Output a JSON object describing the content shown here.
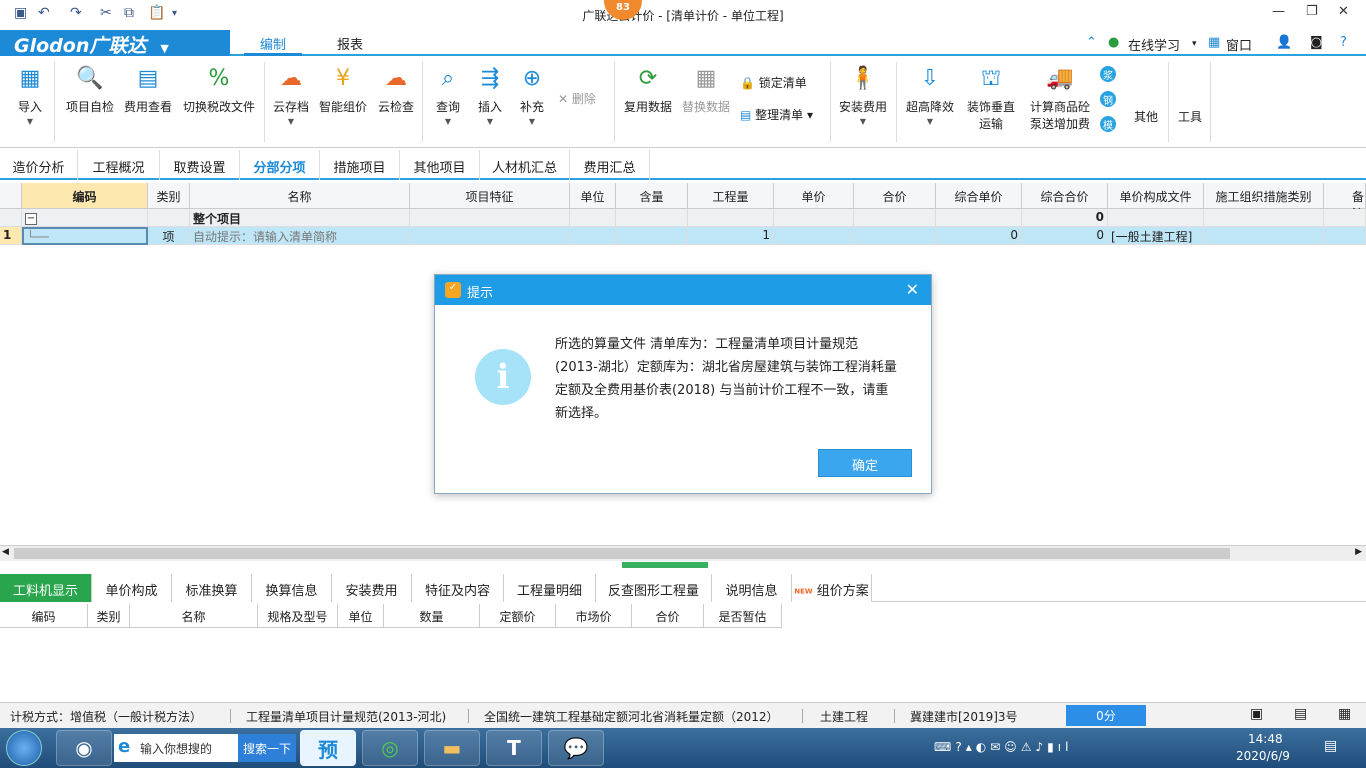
{
  "window": {
    "title": "广联达云计价 - [清单计价 - 单位工程]",
    "badge": "83"
  },
  "logo": {
    "text": "Glodon广联达"
  },
  "menu": {
    "tabs": [
      "编制",
      "报表"
    ],
    "right": {
      "online": "在线学习",
      "window": "窗口"
    }
  },
  "ribbon": {
    "import": "导入",
    "selfcheck": "项目自检",
    "feeview": "费用查看",
    "taxswitch": "切换税改文件",
    "cloudsave": "云存档",
    "smartprice": "智能组价",
    "cloudcheck": "云检查",
    "query": "查询",
    "insert": "插入",
    "supplement": "补充",
    "delete": "删除",
    "reuse": "复用数据",
    "replace": "替换数据",
    "lock": "锁定清单",
    "organize": "整理清单",
    "install": "安装费用",
    "superhigh": "超高降效",
    "decorvert": "装饰垂直",
    "decorvert2": "运输",
    "calcconcrete": "计算商品砼",
    "calcconcrete2": "泵送增加费",
    "small1": "浆",
    "small2": "钢",
    "small3": "模",
    "other": "其他",
    "tools": "工具"
  },
  "navtabs": [
    "造价分析",
    "工程概况",
    "取费设置",
    "分部分项",
    "措施项目",
    "其他项目",
    "人材机汇总",
    "费用汇总"
  ],
  "grid": {
    "headers": [
      "编码",
      "类别",
      "名称",
      "项目特征",
      "单位",
      "含量",
      "工程量",
      "单价",
      "合价",
      "综合单价",
      "综合合价",
      "单价构成文件",
      "施工组织措施类别",
      "备注"
    ],
    "row1": {
      "collapse": "−",
      "name": "整个项目",
      "total": "0"
    },
    "row2": {
      "no": "1",
      "type": "项",
      "name": "自动提示：请输入清单简称",
      "qty": "1",
      "unit_price": "0",
      "total": "0",
      "file": "[一般土建工程]"
    }
  },
  "bottomtabs": [
    "工料机显示",
    "单价构成",
    "标准换算",
    "换算信息",
    "安装费用",
    "特征及内容",
    "工程量明细",
    "反查图形工程量",
    "说明信息",
    "组价方案"
  ],
  "newbadge": "NEW",
  "bottomheaders": [
    "编码",
    "类别",
    "名称",
    "规格及型号",
    "单位",
    "数量",
    "定额价",
    "市场价",
    "合价",
    "是否暂估"
  ],
  "status": {
    "tax": "计税方式：增值税（一般计税方法）",
    "spec": "工程量清单项目计量规范(2013-河北)",
    "quota": "全国统一建筑工程基础定额河北省消耗量定额（2012）",
    "type": "土建工程",
    "doc": "冀建建市[2019]3号",
    "score": "0分"
  },
  "dialog": {
    "title": "提示",
    "message": "所选的算量文件 清单库为：工程量清单项目计量规范(2013-湖北）定额库为：湖北省房屋建筑与装饰工程消耗量定额及全费用基价表(2018) 与当前计价工程不一致，请重新选择。",
    "ok": "确定"
  },
  "taskbar": {
    "search_placeholder": "输入你想搜的",
    "search_button": "搜索一下",
    "time": "14:48",
    "date": "2020/6/9",
    "app_yu": "预"
  }
}
